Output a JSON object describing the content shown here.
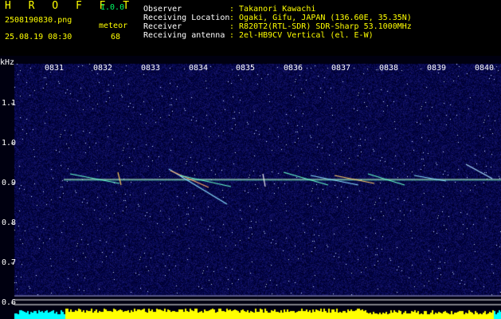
{
  "header": {
    "app_title": "H R O F F T",
    "app_version": "1.0.0",
    "filename": "2508190830.png",
    "datetime": "25.08.19 08:30",
    "meteor_label": "meteor",
    "meteor_count": "68",
    "fields": [
      {
        "label": "Observer",
        "value": ": Takanori Kawachi"
      },
      {
        "label": "Receiving Location",
        "value": ": Ogaki, Gifu, JAPAN (136.60E, 35.35N)"
      },
      {
        "label": "Receiver",
        "value": ": R820T2(RTL-SDR) SDR-Sharp 53.1000MHz"
      },
      {
        "label": "Receiving antenna",
        "value": ": 2el-HB9CV Vertical (el. E-W)"
      }
    ]
  },
  "axis": {
    "unit": "kHz",
    "time_ticks": [
      "0831",
      "0832",
      "0833",
      "0834",
      "0835",
      "0836",
      "0837",
      "0838",
      "0839",
      "0840"
    ],
    "freq_ticks": [
      "1.1",
      "1.0",
      "0.9",
      "0.8",
      "0.7",
      "0.6"
    ]
  },
  "colors": {
    "background": "#000000",
    "noise": "#1a1a7a",
    "trace": "#b0ffb0",
    "bars": "#ffff00",
    "header_text": "#ffff00",
    "label_text": "#ffffff",
    "version": "#00ff66"
  }
}
